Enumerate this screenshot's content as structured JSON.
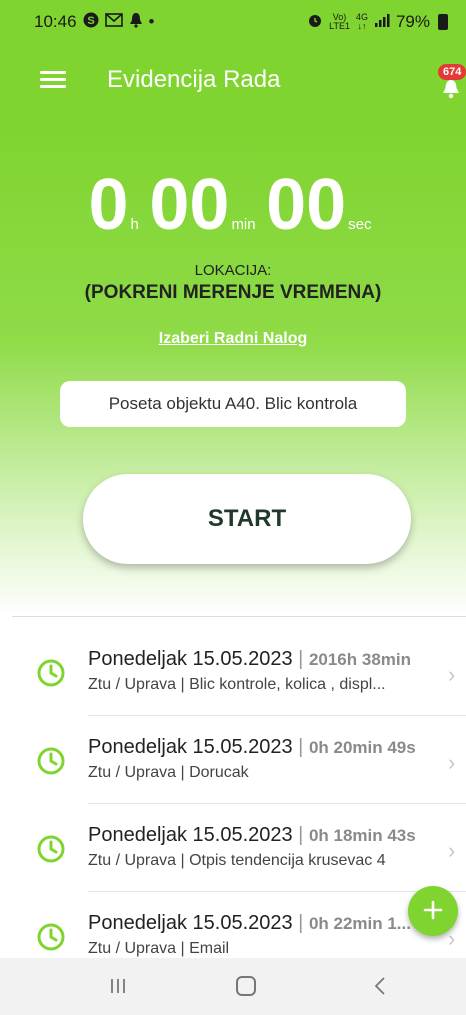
{
  "status_bar": {
    "time": "10:46",
    "icons_left": [
      "skype-icon",
      "gmail-icon",
      "notification-icon",
      "dot-icon"
    ],
    "icons_right": [
      "alarm-icon",
      "volte-icon",
      "4g-icon",
      "signal-icon"
    ],
    "battery": "79%"
  },
  "app_bar": {
    "title": "Evidencija Rada",
    "badge_count": "674",
    "accent_color": "#7fd42f"
  },
  "timer": {
    "hours": "0",
    "hours_unit": "h",
    "minutes": "00",
    "minutes_unit": "min",
    "seconds": "00",
    "seconds_unit": "sec"
  },
  "location": {
    "label": "LOKACIJA:",
    "value": "(POKRENI MERENJE VREMENA)"
  },
  "work_order_link": "Izaberi Radni Nalog",
  "task_input_value": "Poseta objektu A40. Blic kontrola",
  "start_button": "START",
  "entries": [
    {
      "date": "Ponedeljak 15.05.2023",
      "separator": " | ",
      "duration": "2016h 38min",
      "subtitle": "Ztu / Uprava | Blic kontrole, kolica , displ..."
    },
    {
      "date": "Ponedeljak 15.05.2023",
      "separator": " | ",
      "duration": "0h 20min 49s",
      "subtitle": "Ztu / Uprava | Dorucak"
    },
    {
      "date": "Ponedeljak 15.05.2023",
      "separator": " | ",
      "duration": "0h 18min 43s",
      "subtitle": "Ztu / Uprava | Otpis tendencija krusevac 4"
    },
    {
      "date": "Ponedeljak 15.05.2023",
      "separator": " | ",
      "duration": "0h 22min 1...",
      "subtitle": "Ztu / Uprava | Email"
    }
  ]
}
